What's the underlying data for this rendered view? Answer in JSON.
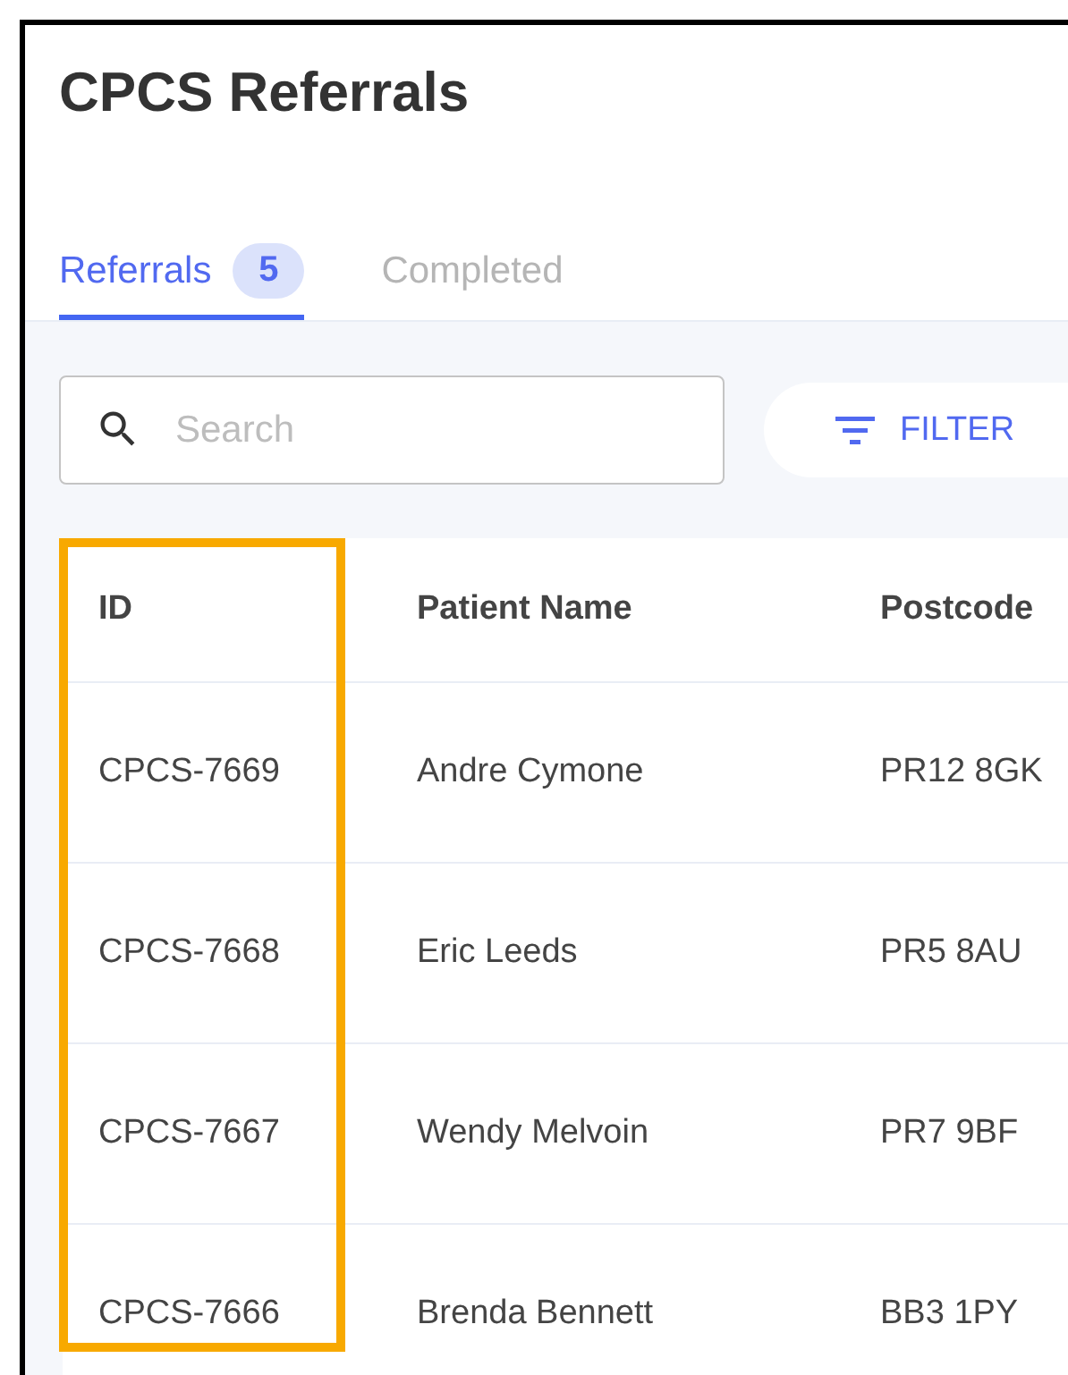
{
  "window": {
    "title": "CPCS Referrals"
  },
  "tabs": [
    {
      "label": "Referrals",
      "count": "5",
      "selected": true
    },
    {
      "label": "Completed",
      "selected": false
    }
  ],
  "search": {
    "placeholder": "Search"
  },
  "filter_button": {
    "label": "FILTER"
  },
  "table": {
    "columns": [
      {
        "label": "ID",
        "highlighted": true
      },
      {
        "label": "Patient Name",
        "highlighted": false
      },
      {
        "label": "Postcode",
        "highlighted": false
      }
    ],
    "rows": [
      [
        "CPCS-7669",
        "Andre Cymone",
        "PR12 8GK"
      ],
      [
        "CPCS-7668",
        "Eric Leeds",
        "PR5 8AU"
      ],
      [
        "CPCS-7667",
        "Wendy Melvoin",
        "PR7 9BF"
      ],
      [
        "CPCS-7666",
        "Brenda Bennett",
        "BB3 1PY"
      ]
    ]
  }
}
